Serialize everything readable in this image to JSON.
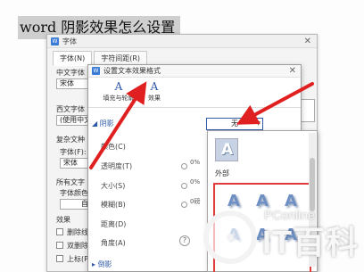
{
  "document": {
    "heading": "word 阴影效果怎么设置"
  },
  "font_dialog": {
    "title": "字体",
    "tabs": [
      "字体(N)",
      "字符间距(R)"
    ],
    "chinese_font_label": "中文字体",
    "chinese_font_value": "宋体",
    "western_font_label": "西文字体",
    "western_font_value": "(使用中文字",
    "complex_label": "复杂文种",
    "complex_font_label": "字体(F):",
    "complex_font_value": "宋体",
    "all_text_label": "所有文字",
    "font_color_label": "字体颜色",
    "font_color_value": "自",
    "effects_label": "效果",
    "effect_items": [
      "删除线",
      "双删除",
      "上标(P"
    ]
  },
  "effects_dialog": {
    "title": "设置文本效果格式",
    "tabs": [
      {
        "glyph": "A",
        "label": "填充与轮廓"
      },
      {
        "glyph": "A",
        "label": "效果"
      }
    ],
    "section": "阴影",
    "preset_value": "无",
    "properties": [
      {
        "label": "颜色(C)"
      },
      {
        "label": "透明度(T)",
        "value": "0%"
      },
      {
        "label": "大小(S)",
        "value": "0%"
      },
      {
        "label": "模糊(B)",
        "value": "0磅"
      },
      {
        "label": "距离(D)"
      },
      {
        "label": "角度(A)"
      }
    ],
    "bottom_section": "倒影",
    "help": "?"
  },
  "shadow_dropdown": {
    "none_tile_glyph": "A",
    "group_label": "外部",
    "presets": [
      "A",
      "A",
      "A",
      "A",
      "A",
      "A"
    ]
  },
  "watermark": {
    "site": "PConline",
    "brand": "IT百科"
  },
  "colors": {
    "annotation_arrow": "#e02020",
    "accent": "#2e5aa8",
    "highlight_box": "#e23b3b"
  }
}
